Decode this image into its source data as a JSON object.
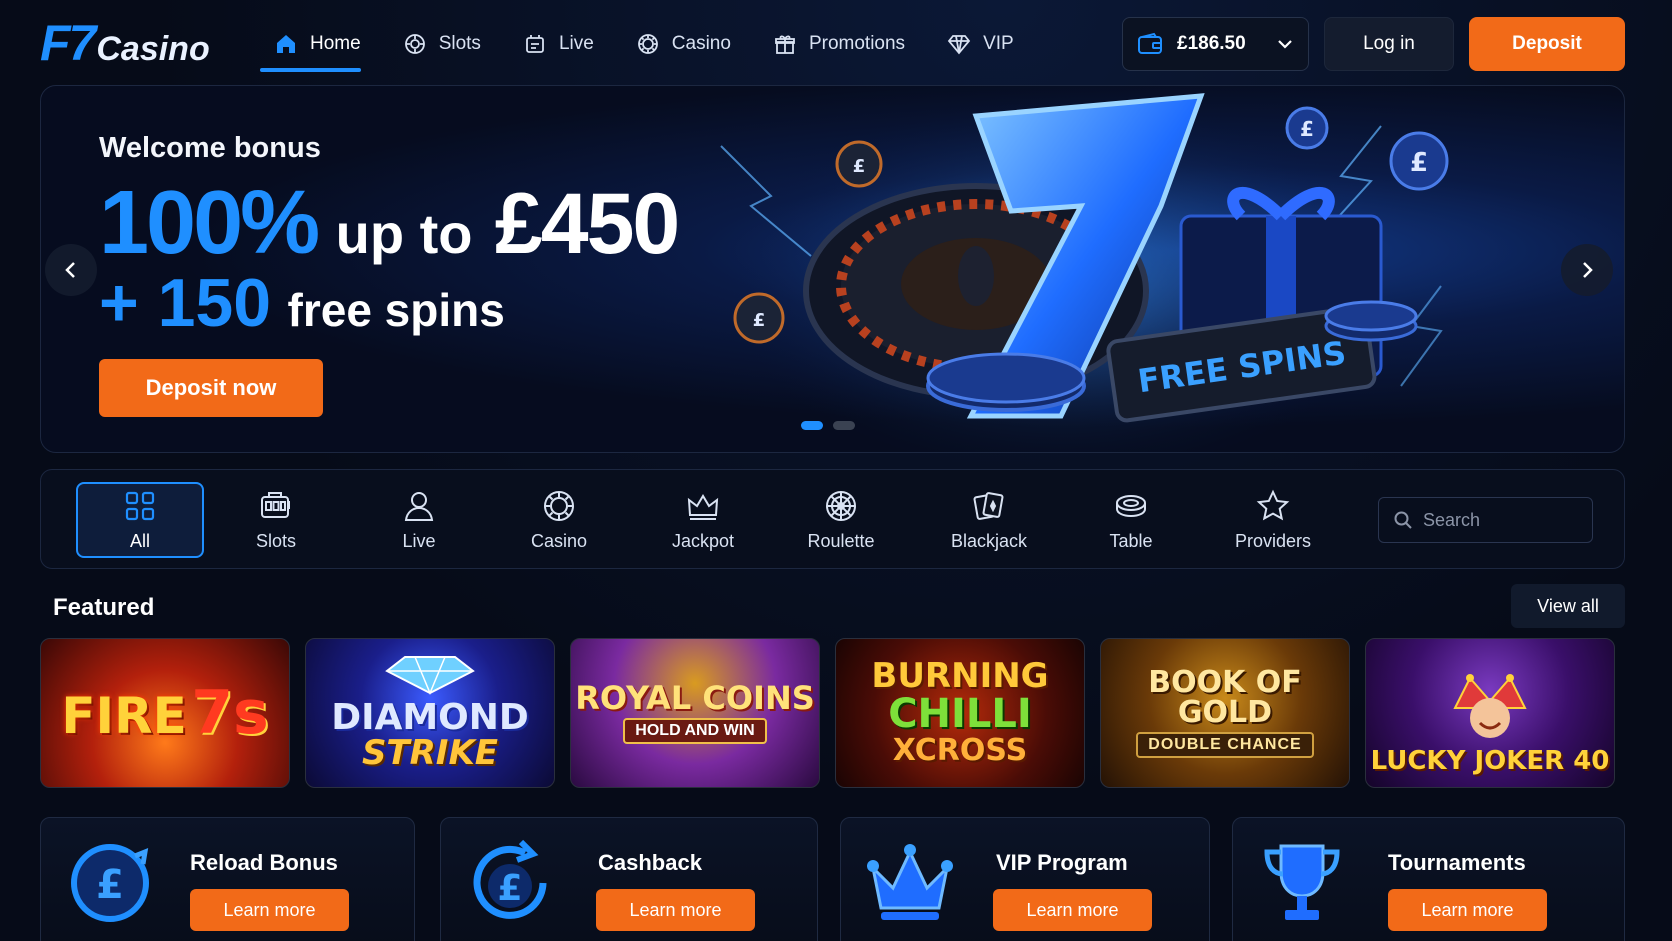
{
  "header": {
    "logo_f7": "F7",
    "logo_casino": "Casino",
    "nav": [
      {
        "label": "Home",
        "icon": "home-icon",
        "active": true
      },
      {
        "label": "Slots",
        "icon": "slots-chip-icon"
      },
      {
        "label": "Live",
        "icon": "live-icon"
      },
      {
        "label": "Casino",
        "icon": "casino-chip-icon"
      },
      {
        "label": "Promotions",
        "icon": "gift-icon"
      },
      {
        "label": "VIP",
        "icon": "diamond-icon"
      }
    ],
    "balance": "£186.50",
    "login_label": "Log in",
    "deposit_label": "Deposit"
  },
  "hero": {
    "eyebrow": "Welcome bonus",
    "percent": "100%",
    "up_to": "up to",
    "amount": "£450",
    "spins_count": "+ 150",
    "spins_text": "free spins",
    "cta": "Deposit now",
    "ticket_text": "FREE SPINS",
    "chip_symbol": "£",
    "slides": 2,
    "active_slide": 1
  },
  "categories": {
    "items": [
      {
        "label": "All",
        "icon": "grid-icon",
        "active": true
      },
      {
        "label": "Slots",
        "icon": "slot-machine-icon"
      },
      {
        "label": "Live",
        "icon": "person-icon"
      },
      {
        "label": "Casino",
        "icon": "chip-icon"
      },
      {
        "label": "Jackpot",
        "icon": "crown-icon"
      },
      {
        "label": "Roulette",
        "icon": "roulette-icon"
      },
      {
        "label": "Blackjack",
        "icon": "cards-icon"
      },
      {
        "label": "Table",
        "icon": "table-chips-icon"
      },
      {
        "label": "Providers",
        "icon": "star-icon"
      }
    ],
    "search_placeholder": "Search"
  },
  "featured": {
    "title": "Featured",
    "view_all": "View all",
    "games": [
      {
        "line1": "FIRE",
        "line2": "7s",
        "sub": ""
      },
      {
        "line1": "DIAMOND",
        "line2": "STRIKE",
        "sub": ""
      },
      {
        "line1": "ROYAL COINS",
        "line2": "",
        "sub": "HOLD AND WIN"
      },
      {
        "line1": "BURNING",
        "line2": "CHILLI",
        "sub": "XCROSS"
      },
      {
        "line1": "BOOK OF GOLD",
        "line2": "",
        "sub": "DOUBLE CHANCE"
      },
      {
        "line1": "",
        "line2": "LUCKY JOKER 40",
        "sub": ""
      }
    ]
  },
  "promos": [
    {
      "title": "Reload Bonus",
      "button": "Learn more",
      "icon": "pound-refresh-icon"
    },
    {
      "title": "Cashback",
      "button": "Learn more",
      "icon": "pound-cycle-icon"
    },
    {
      "title": "VIP Program",
      "button": "Learn more",
      "icon": "crown-icon"
    },
    {
      "title": "Tournaments",
      "button": "Learn more",
      "icon": "trophy-icon"
    }
  ],
  "colors": {
    "accent_blue": "#1f8fff",
    "accent_orange": "#f26a18",
    "background": "#060b18"
  }
}
